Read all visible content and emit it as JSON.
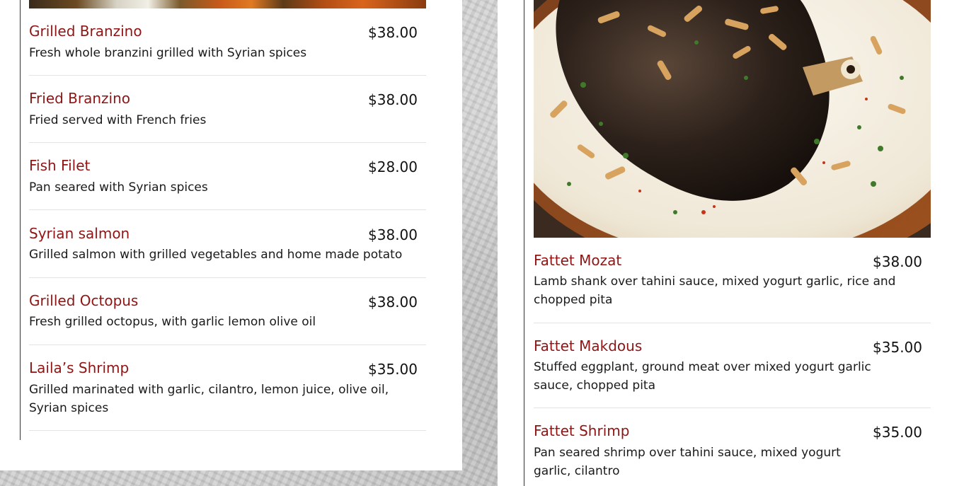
{
  "left_menu": {
    "items": [
      {
        "name": "Grilled Branzino",
        "price": "$38.00",
        "description": "Fresh whole branzini grilled with Syrian spices"
      },
      {
        "name": "Fried Branzino",
        "price": "$38.00",
        "description": "Fried served with French fries"
      },
      {
        "name": "Fish Filet",
        "price": "$28.00",
        "description": "Pan seared with Syrian spices"
      },
      {
        "name": "Syrian salmon",
        "price": "$38.00",
        "description": "Grilled salmon with grilled vegetables and home made potato"
      },
      {
        "name": "Grilled Octopus",
        "price": "$38.00",
        "description": "Fresh grilled octopus, with garlic lemon olive oil"
      },
      {
        "name": "Laila’s Shrimp",
        "price": "$35.00",
        "description": "Grilled marinated with garlic, cilantro, lemon juice, olive oil, Syrian spices"
      }
    ]
  },
  "right_menu": {
    "items": [
      {
        "name": "Fattet Mozat",
        "price": "$38.00",
        "description": "Lamb shank over tahini sauce, mixed yogurt garlic, rice and chopped pita"
      },
      {
        "name": "Fattet Makdous",
        "price": "$35.00",
        "description": "Stuffed eggplant, ground meat over mixed yogurt garlic sauce, chopped pita"
      },
      {
        "name": "Fattet Shrimp",
        "price": "$35.00",
        "description": "Pan seared shrimp over tahini sauce, mixed yogurt garlic, cilantro"
      }
    ]
  },
  "colors": {
    "item_name": "#8f1515",
    "price": "#111111",
    "divider": "#e3e3e3"
  }
}
